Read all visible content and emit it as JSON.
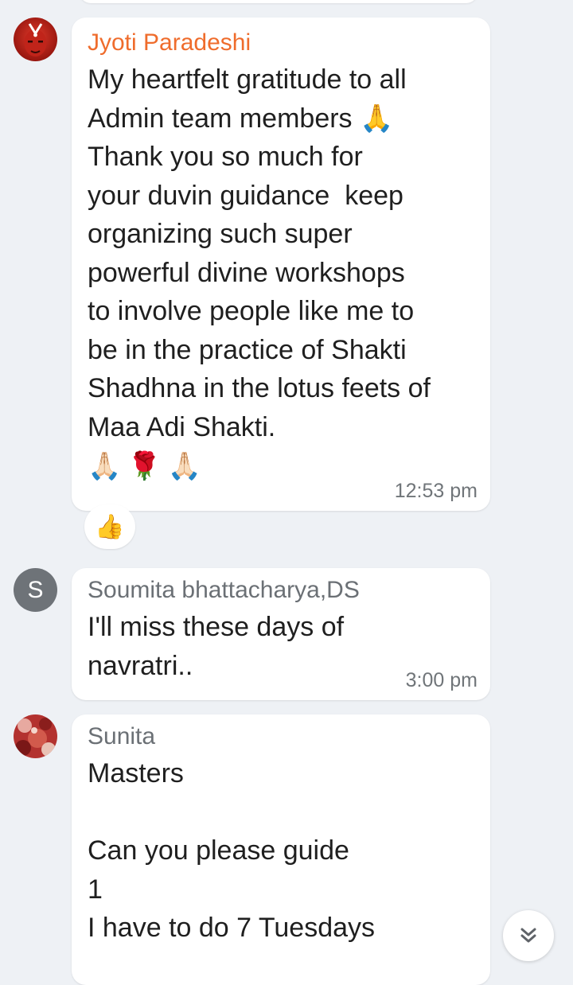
{
  "messages": [
    {
      "sender": "Jyoti Paradeshi",
      "sender_color": "#ef6c2c",
      "avatar_icon": "deity-avatar",
      "text": "My heartfelt gratitude to all\nAdmin team members 🙏\nThank you so much for\nyour duvin guidance  keep\norganizing such super\npowerful divine workshops\nto involve people like me to\nbe in the practice of Shakti\nShadhna in the lotus feets of\nMaa Adi Shakti.",
      "emoji_line": "🙏🏻🌹🙏🏻",
      "time": "12:53 pm",
      "reaction": "👍"
    },
    {
      "sender": "Soumita bhattacharya,DS",
      "sender_color": "#6b7075",
      "avatar_letter": "S",
      "avatar_color": "#6e7378",
      "text": "I'll miss these days of\nnavratri..",
      "time": "3:00 pm"
    },
    {
      "sender": "Sunita",
      "sender_color": "#6b7075",
      "avatar_icon": "photo-avatar",
      "text": "Masters\n\nCan you please guide\n1\nI have to do 7 Tuesdays"
    }
  ],
  "scroll_down_icon": "double-chevron-down-icon"
}
